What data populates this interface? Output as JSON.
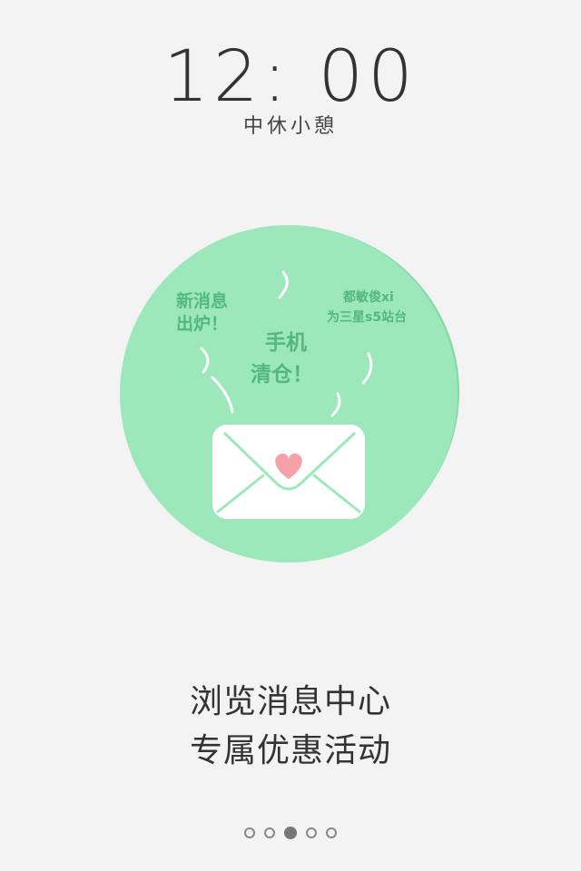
{
  "lockscreen": {
    "time": "12: 00",
    "status": "中休小憩"
  },
  "illustration": {
    "text_left_line1": "新消息",
    "text_left_line2": "出炉！",
    "text_right_line1": "都敏俊xi",
    "text_right_line2": "为三星s5站台",
    "text_center_line1": "手机",
    "text_center_line2": "清仓！",
    "colors": {
      "circle": "#9de8bb",
      "circle_shadow": "#86d9a7",
      "envelope": "#ffffff",
      "envelope_lines": "#9de8bb",
      "heart": "#f6a1a9",
      "handwriting": "#52b87e"
    }
  },
  "captions": {
    "line1": "浏览消息中心",
    "line2": "专属优惠活动"
  },
  "pager": {
    "total": 5,
    "active_index": 2
  }
}
